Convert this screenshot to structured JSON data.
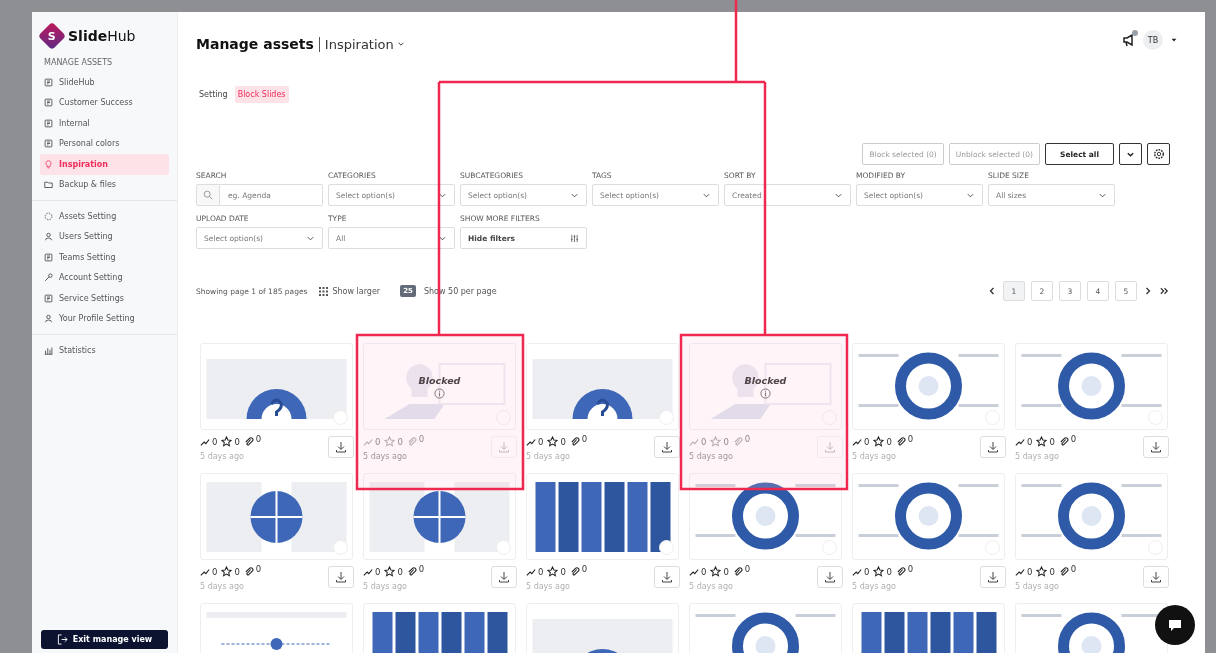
{
  "brand": {
    "mark": "S",
    "name": "**Slide**Hub"
  },
  "sidebar": {
    "section": "MANAGE ASSETS",
    "groups": [
      [
        {
          "label": "SlideHub",
          "selected": false
        },
        {
          "label": "Customer Success",
          "selected": false
        },
        {
          "label": "Internal",
          "selected": false
        },
        {
          "label": "Personal colors",
          "selected": false
        },
        {
          "label": "Inspiration",
          "selected": true
        },
        {
          "label": "Backup & files",
          "selected": false
        }
      ],
      [
        {
          "label": "Assets Setting",
          "selected": false
        },
        {
          "label": "Users Setting",
          "selected": false
        },
        {
          "label": "Teams Setting",
          "selected": false
        },
        {
          "label": "Account Setting",
          "selected": false
        },
        {
          "label": "Service Settings",
          "selected": false
        },
        {
          "label": "Your Profile Setting",
          "selected": false
        }
      ],
      [
        {
          "label": "Statistics",
          "selected": false
        }
      ]
    ],
    "exit_button": "Exit manage view"
  },
  "header": {
    "title": "Manage assets",
    "subtitle": "Inspiration",
    "avatar": "TB",
    "notification": true
  },
  "tabs": [
    {
      "label": "Setting",
      "selected": false
    },
    {
      "label": "Block Slides",
      "selected": true
    }
  ],
  "actions": [
    {
      "kind": "text",
      "label": "Block selected (0)",
      "disabled": true
    },
    {
      "kind": "text",
      "label": "Unblock selected (0)",
      "disabled": true
    },
    {
      "kind": "text",
      "label": "Select all",
      "disabled": false
    },
    {
      "kind": "caret"
    },
    {
      "kind": "gear"
    }
  ],
  "filters": [
    {
      "label": "SEARCH",
      "kind": "search",
      "placeholder": "eg. Agenda"
    },
    {
      "label": "CATEGORIES",
      "kind": "select",
      "value": "Select option(s)"
    },
    {
      "label": "SUBCATEGORIES",
      "kind": "select",
      "value": "Select option(s)"
    },
    {
      "label": "TAGS",
      "kind": "select",
      "value": "Select option(s)"
    },
    {
      "label": "SORT BY",
      "kind": "select",
      "value": "Created"
    },
    {
      "label": "MODIFIED BY",
      "kind": "select",
      "value": "Select option(s)"
    },
    {
      "label": "SLIDE SIZE",
      "kind": "select",
      "value": "All sizes"
    },
    {
      "label": "UPLOAD DATE",
      "kind": "select",
      "value": "Select option(s)"
    },
    {
      "label": "TYPE",
      "kind": "select",
      "value": "All"
    },
    {
      "label": "SHOW MORE FILTERS",
      "kind": "button",
      "value": "Hide filters"
    }
  ],
  "pagination": {
    "summary": "Showing page 1 of 185 pages",
    "show_larger": "Show larger",
    "per_page_badge": "25",
    "per_page_link": "Show 50 per page",
    "pages": [
      {
        "label": "1",
        "selected": true
      },
      {
        "label": "2",
        "selected": false
      },
      {
        "label": "3",
        "selected": false
      },
      {
        "label": "4",
        "selected": false
      },
      {
        "label": "5",
        "selected": false
      }
    ]
  },
  "cards": [
    {
      "kind": "gauge",
      "blocked": false,
      "stats": [
        "0",
        "0",
        "0"
      ],
      "date": "5 days ago"
    },
    {
      "kind": "bulb",
      "blocked": true,
      "blocked_label": "Blocked",
      "stats": [
        "0",
        "0",
        "0"
      ],
      "date": "5 days ago"
    },
    {
      "kind": "gauge",
      "blocked": false,
      "stats": [
        "0",
        "0",
        "0"
      ],
      "date": "5 days ago"
    },
    {
      "kind": "bulb",
      "blocked": true,
      "blocked_label": "Blocked",
      "stats": [
        "0",
        "0",
        "0"
      ],
      "date": "5 days ago"
    },
    {
      "kind": "ring",
      "blocked": false,
      "stats": [
        "0",
        "0",
        "0"
      ],
      "date": "5 days ago"
    },
    {
      "kind": "ring",
      "blocked": false,
      "stats": [
        "0",
        "0",
        "0"
      ],
      "date": "5 days ago"
    },
    {
      "kind": "puzzle",
      "blocked": false,
      "stats": [
        "0",
        "0",
        "0"
      ],
      "date": "5 days ago"
    },
    {
      "kind": "puzzle",
      "blocked": false,
      "stats": [
        "0",
        "0",
        "0"
      ],
      "date": "5 days ago"
    },
    {
      "kind": "columns",
      "blocked": false,
      "stats": [
        "0",
        "0",
        "0"
      ],
      "date": "5 days ago"
    },
    {
      "kind": "ring",
      "blocked": false,
      "stats": [
        "0",
        "0",
        "0"
      ],
      "date": "5 days ago"
    },
    {
      "kind": "ring",
      "blocked": false,
      "stats": [
        "0",
        "0",
        "0"
      ],
      "date": "5 days ago"
    },
    {
      "kind": "ring",
      "blocked": false,
      "stats": [
        "0",
        "0",
        "0"
      ],
      "date": "5 days ago"
    },
    {
      "kind": "flow",
      "blocked": false
    },
    {
      "kind": "columns",
      "blocked": false
    },
    {
      "kind": "gauge",
      "blocked": false
    },
    {
      "kind": "ring",
      "blocked": false
    },
    {
      "kind": "columns",
      "blocked": false
    },
    {
      "kind": "ring",
      "blocked": false
    }
  ],
  "annotation": true
}
